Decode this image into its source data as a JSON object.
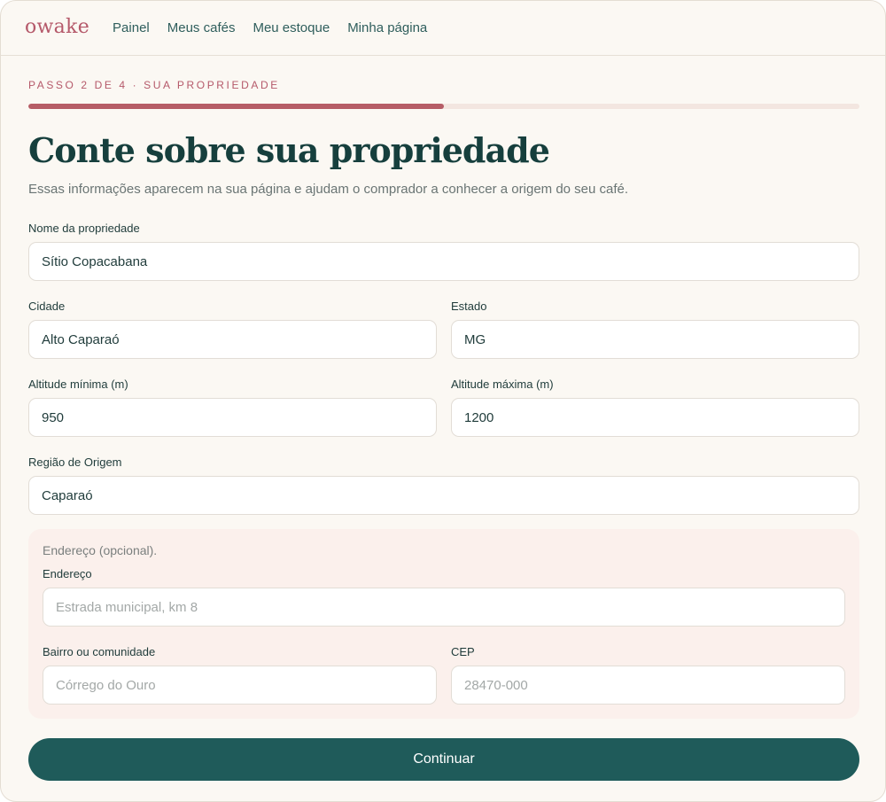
{
  "brand": {
    "logo": "owake"
  },
  "nav": {
    "items": [
      {
        "label": "Painel"
      },
      {
        "label": "Meus cafés"
      },
      {
        "label": "Meu estoque"
      },
      {
        "label": "Minha página"
      }
    ]
  },
  "wizard": {
    "step_label": "PASSO 2 DE 4 · SUA PROPRIEDADE",
    "progress_fraction": 0.5,
    "title": "Conte sobre sua propriedade",
    "subtitle": "Essas informações aparecem na sua página e ajudam o comprador a conhecer a origem do seu café."
  },
  "form": {
    "farm_name": {
      "label": "Nome da propriedade",
      "value": "Sítio Copacabana"
    },
    "city": {
      "label": "Cidade",
      "value": "Alto Caparaó"
    },
    "state": {
      "label": "Estado",
      "value": "MG"
    },
    "alt_min": {
      "label": "Altitude mínima (m)",
      "value": "950"
    },
    "alt_max": {
      "label": "Altitude máxima (m)",
      "value": "1200"
    },
    "region": {
      "label": "Região de Origem",
      "value": "Caparaó"
    },
    "address_section": {
      "note": "Endereço (opcional).",
      "address": {
        "label": "Endereço",
        "value": "",
        "placeholder": "Estrada municipal, km 8"
      },
      "neighborhood": {
        "label": "Bairro ou comunidade",
        "value": "",
        "placeholder": "Córrego do Ouro"
      },
      "zip": {
        "label": "CEP",
        "value": "",
        "placeholder": "28470-000"
      }
    },
    "submit_label": "Continuar"
  },
  "colors": {
    "accent": "#b5596a",
    "primary": "#1f5b5a",
    "background": "#fbf8f3",
    "address_box": "#fbf0ec"
  }
}
